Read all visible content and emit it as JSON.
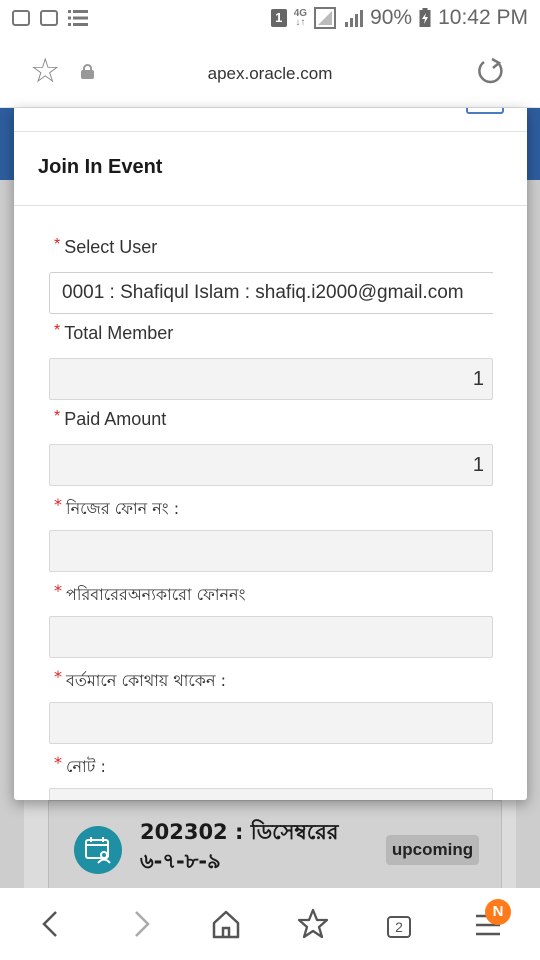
{
  "status_bar": {
    "sim_badge": "1",
    "network_top": "4G",
    "network_bottom": "↓↑",
    "battery": "90%",
    "time": "10:42 PM"
  },
  "browser": {
    "url": "apex.oracle.com"
  },
  "dialog": {
    "title": "Join In Event",
    "required_mark": "*",
    "fields": [
      {
        "label": "Select User",
        "value": "0001 : Shafiqul Islam : shafiq.i2000@gmail.com"
      },
      {
        "label": "Total Member",
        "value": "1"
      },
      {
        "label": "Paid Amount",
        "value": "1"
      },
      {
        "label": "নিজের ফোন নং :",
        "value": ""
      },
      {
        "label": "পরিবারেরঅন্যকারো ফোননং",
        "value": ""
      },
      {
        "label": "বর্তমানে কোথায় থাকেন :",
        "value": ""
      },
      {
        "label": "নোট :",
        "value": ""
      }
    ]
  },
  "background_card": {
    "title": "202302 : ডিসেম্বরের ৬-৭-৮-৯",
    "badge": "upcoming"
  },
  "bottom_nav": {
    "tab_count": "2",
    "notification_badge": "N"
  },
  "colors": {
    "required": "#dd2222",
    "header_blue": "#2e5d9e",
    "event_icon": "#1f8fa3",
    "notification": "#ff7a1a"
  }
}
